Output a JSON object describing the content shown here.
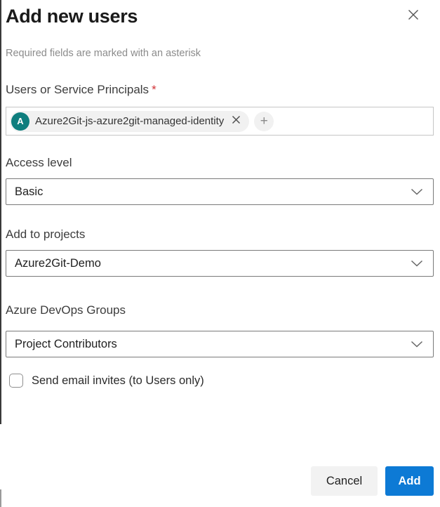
{
  "dialog": {
    "title": "Add new users",
    "required_note": "Required fields are marked with an asterisk"
  },
  "users_field": {
    "label": "Users or Service Principals",
    "required_marker": "*",
    "chip": {
      "avatar_initial": "A",
      "name": "Azure2Git-js-azure2git-managed-identity"
    },
    "add_icon": "+"
  },
  "access_level": {
    "label": "Access level",
    "value": "Basic"
  },
  "projects": {
    "label": "Add to projects",
    "value": "Azure2Git-Demo"
  },
  "groups": {
    "label": "Azure DevOps Groups",
    "value": "Project Contributors"
  },
  "email_invites": {
    "label": "Send email invites (to Users only)",
    "checked": false
  },
  "footer": {
    "cancel_label": "Cancel",
    "add_label": "Add"
  },
  "icons": {
    "close": "close-icon",
    "chip_remove": "remove-icon",
    "add_person": "plus-icon",
    "dropdown": "chevron-down-icon"
  },
  "colors": {
    "accent_blue": "#0d7ad5",
    "avatar_teal": "#0f7e7e",
    "required_red": "#d13438",
    "chip_background": "#f1f1f1",
    "cancel_background": "#f2f2f2"
  }
}
